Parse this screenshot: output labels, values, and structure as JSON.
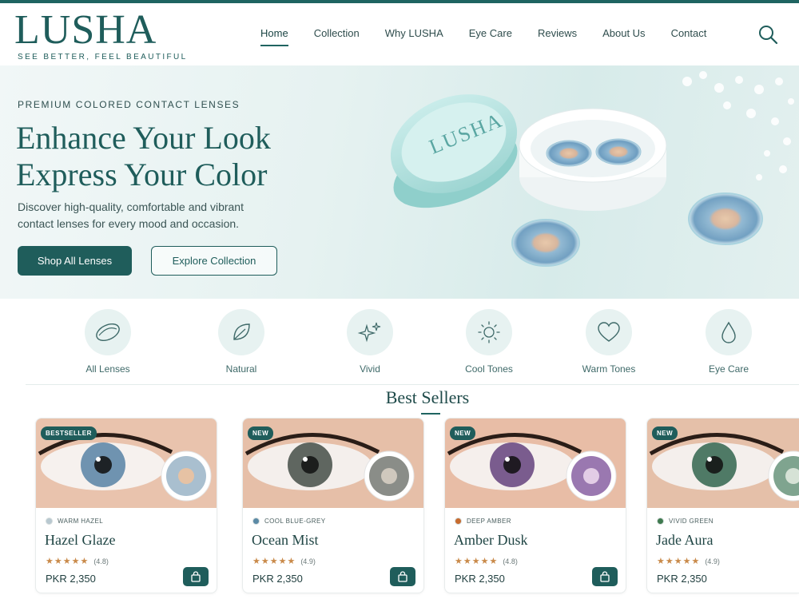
{
  "brand": {
    "name": "LUSHA",
    "tagline": "SEE BETTER, FEEL BEAUTIFUL"
  },
  "nav": {
    "items": [
      {
        "label": "Home",
        "active": true
      },
      {
        "label": "Collection"
      },
      {
        "label": "Why LUSHA"
      },
      {
        "label": "Eye Care"
      },
      {
        "label": "Reviews"
      },
      {
        "label": "About Us"
      },
      {
        "label": "Contact"
      }
    ],
    "search_icon": "search-icon"
  },
  "hero": {
    "eyebrow": "PREMIUM COLORED CONTACT LENSES",
    "title_line1": "Enhance Your Look",
    "title_line2": "Express Your Color",
    "description": "Discover high-quality, comfortable and vibrant contact lenses for every mood and occasion.",
    "primary_button": "Shop All Lenses",
    "secondary_button": "Explore Collection",
    "case_label": "LUSHA"
  },
  "categories": [
    {
      "label": "All Lenses",
      "icon": "lens-icon"
    },
    {
      "label": "Natural",
      "icon": "leaf-icon"
    },
    {
      "label": "Vivid",
      "icon": "sparkle-icon"
    },
    {
      "label": "Cool Tones",
      "icon": "sun-icon"
    },
    {
      "label": "Warm Tones",
      "icon": "heart-icon"
    },
    {
      "label": "Eye Care",
      "icon": "drop-icon"
    }
  ],
  "best_sellers": {
    "title": "Best Sellers",
    "products": [
      {
        "badge": "BESTSELLER",
        "color_label": "WARM HAZEL",
        "swatch": "#b8c8d0",
        "name": "Hazel Glaze",
        "stars": "★★★★★",
        "rating": "(4.8)",
        "price": "PKR 2,350",
        "iris": "#6f93b0"
      },
      {
        "badge": "NEW",
        "color_label": "COOL BLUE-GREY",
        "swatch": "#5b8aa6",
        "name": "Ocean Mist",
        "stars": "★★★★★",
        "rating": "(4.9)",
        "price": "PKR 2,350",
        "iris": "#5f6660"
      },
      {
        "badge": "NEW",
        "color_label": "DEEP AMBER",
        "swatch": "#c76b2e",
        "name": "Amber Dusk",
        "stars": "★★★★★",
        "rating": "(4.8)",
        "price": "PKR 2,350",
        "iris": "#7a5c8e"
      },
      {
        "badge": "NEW",
        "color_label": "VIVID GREEN",
        "swatch": "#3f7a4f",
        "name": "Jade Aura",
        "stars": "★★★★★",
        "rating": "(4.9)",
        "price": "PKR 2,350",
        "iris": "#4f7a66"
      }
    ]
  }
}
